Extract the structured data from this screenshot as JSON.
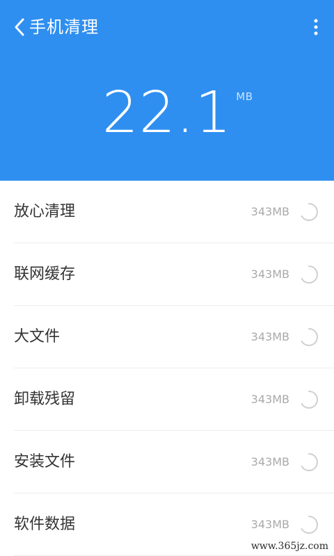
{
  "header": {
    "title": "手机清理",
    "icons": {
      "back": "chevron-left-icon",
      "menu": "more-vertical-icon"
    },
    "amount": {
      "value": "22.1",
      "unit": "MB"
    },
    "color": "#2f8ff0"
  },
  "list": {
    "items": [
      {
        "label": "放心清理",
        "size": "343MB"
      },
      {
        "label": "联网缓存",
        "size": "343MB"
      },
      {
        "label": "大文件",
        "size": "343MB"
      },
      {
        "label": "卸载残留",
        "size": "343MB"
      },
      {
        "label": "安装文件",
        "size": "343MB"
      },
      {
        "label": "软件数据",
        "size": "343MB"
      }
    ],
    "status_icon": "loading-spinner-icon"
  },
  "watermark": "www.365jz.com"
}
